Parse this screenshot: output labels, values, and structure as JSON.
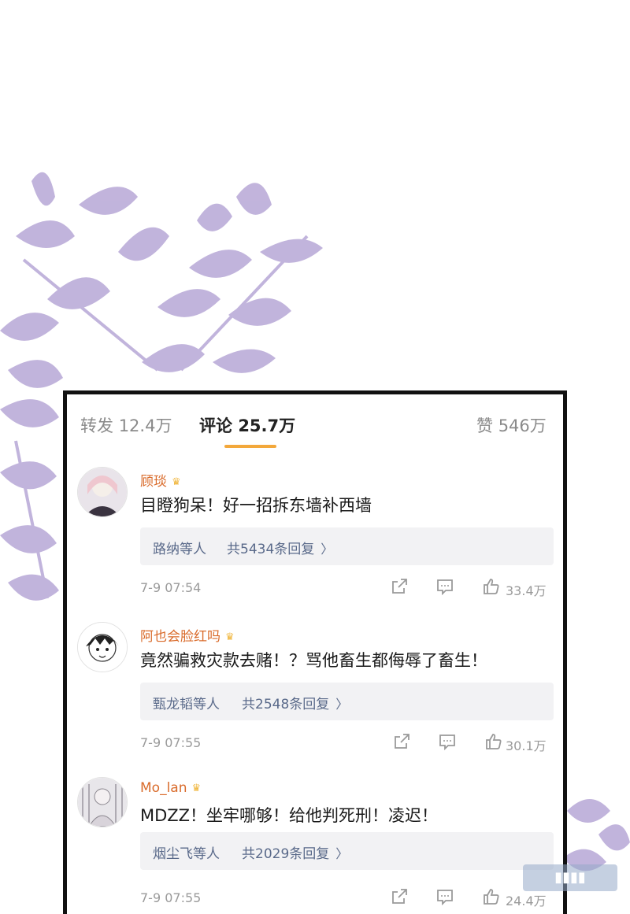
{
  "tabs": {
    "repost_label": "转发",
    "repost_count": "12.4万",
    "comments_label": "评论",
    "comments_count": "25.7万",
    "likes_label": "赞",
    "likes_count": "546万"
  },
  "comments": [
    {
      "user": "顾琰",
      "text": "目瞪狗呆！好一招拆东墙补西墙",
      "reply_users": "路纳等人",
      "reply_count": "共5434条回复",
      "time": "7-9 07:54",
      "likes": "33.4万"
    },
    {
      "user": "阿也会脸红吗",
      "text": "竟然骗救灾款去赌！？骂他畜生都侮辱了畜生！",
      "reply_users": "甄龙韬等人",
      "reply_count": "共2548条回复",
      "time": "7-9 07:55",
      "likes": "30.1万"
    },
    {
      "user": "Mo_lan",
      "text": "MDZZ！坐牢哪够！给他判死刑！凌迟！",
      "reply_users": "烟尘飞等人",
      "reply_count": "共2029条回复",
      "time": "7-9 07:55",
      "likes": "24.4万"
    }
  ],
  "icons": {
    "share": "share-icon",
    "comment": "comment-icon",
    "like": "thumbs-up-icon",
    "crown": "crown-badge-icon",
    "chevron": "chevron-right-icon"
  },
  "colors": {
    "leaf": "#b7a7d6",
    "username": "#d96b2b",
    "tab_underline": "#f3a83b",
    "reply_text": "#5a6a8a",
    "reply_bg": "#f2f2f4"
  }
}
